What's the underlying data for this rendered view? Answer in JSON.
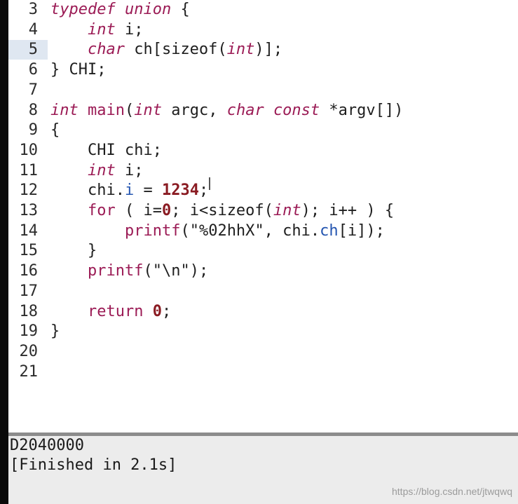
{
  "editor": {
    "current_line": "5",
    "lines": [
      {
        "n": "3",
        "segments": [
          [
            "kw",
            "typedef"
          ],
          [
            "t",
            " "
          ],
          [
            "kw",
            "union"
          ],
          [
            "t",
            " {"
          ]
        ]
      },
      {
        "n": "4",
        "segments": [
          [
            "t",
            "    "
          ],
          [
            "kw",
            "int"
          ],
          [
            "t",
            " i;"
          ]
        ]
      },
      {
        "n": "5",
        "segments": [
          [
            "t",
            "    "
          ],
          [
            "kw",
            "char"
          ],
          [
            "t",
            " ch[sizeof("
          ],
          [
            "kw",
            "int"
          ],
          [
            "t",
            ")];"
          ]
        ]
      },
      {
        "n": "6",
        "segments": [
          [
            "t",
            "} CHI;"
          ]
        ]
      },
      {
        "n": "7",
        "segments": []
      },
      {
        "n": "8",
        "segments": [
          [
            "kw",
            "int"
          ],
          [
            "t",
            " "
          ],
          [
            "kwn",
            "main"
          ],
          [
            "t",
            "("
          ],
          [
            "kw",
            "int"
          ],
          [
            "t",
            " argc, "
          ],
          [
            "kw",
            "char"
          ],
          [
            "t",
            " "
          ],
          [
            "kw",
            "const"
          ],
          [
            "t",
            " *argv[])"
          ]
        ]
      },
      {
        "n": "9",
        "segments": [
          [
            "t",
            "{"
          ]
        ]
      },
      {
        "n": "10",
        "segments": [
          [
            "t",
            "    CHI chi;"
          ]
        ]
      },
      {
        "n": "11",
        "segments": [
          [
            "t",
            "    "
          ],
          [
            "kw",
            "int"
          ],
          [
            "t",
            " i;"
          ]
        ]
      },
      {
        "n": "12",
        "segments": [
          [
            "t",
            "    chi."
          ],
          [
            "mem",
            "i"
          ],
          [
            "t",
            " = "
          ],
          [
            "num",
            "1234"
          ],
          [
            "t",
            ";"
          ]
        ]
      },
      {
        "n": "13",
        "segments": [
          [
            "t",
            "    "
          ],
          [
            "kwn",
            "for"
          ],
          [
            "t",
            " ( i="
          ],
          [
            "num",
            "0"
          ],
          [
            "t",
            "; i<sizeof("
          ],
          [
            "kw",
            "int"
          ],
          [
            "t",
            "); i++ ) {"
          ]
        ]
      },
      {
        "n": "14",
        "segments": [
          [
            "t",
            "        "
          ],
          [
            "kwn",
            "printf"
          ],
          [
            "t",
            "(\""
          ],
          [
            "fmt",
            "%02hhX"
          ],
          [
            "t",
            "\", chi."
          ],
          [
            "mem",
            "ch"
          ],
          [
            "t",
            "[i]);"
          ]
        ]
      },
      {
        "n": "15",
        "segments": [
          [
            "t",
            "    }"
          ]
        ]
      },
      {
        "n": "16",
        "segments": [
          [
            "t",
            "    "
          ],
          [
            "kwn",
            "printf"
          ],
          [
            "t",
            "(\"\\n\");"
          ]
        ]
      },
      {
        "n": "17",
        "segments": []
      },
      {
        "n": "18",
        "segments": [
          [
            "t",
            "    "
          ],
          [
            "kwn",
            "return"
          ],
          [
            "t",
            " "
          ],
          [
            "num",
            "0"
          ],
          [
            "t",
            ";"
          ]
        ]
      },
      {
        "n": "19",
        "segments": [
          [
            "t",
            "}"
          ]
        ]
      },
      {
        "n": "20",
        "segments": []
      },
      {
        "n": "21",
        "segments": []
      }
    ]
  },
  "console": {
    "output_line": "D2040000",
    "status_line": "[Finished in 2.1s]"
  },
  "watermark": {
    "text": "https://blog.csdn.net/jtwqwq"
  },
  "colors": {
    "keyword": "#9b1b55",
    "number": "#8a1b22",
    "member": "#2455b0",
    "current_line_bg": "#dfe7f1"
  }
}
